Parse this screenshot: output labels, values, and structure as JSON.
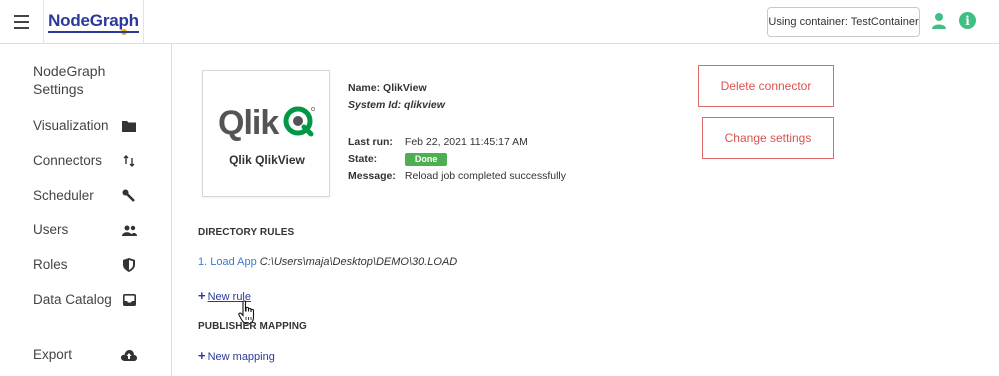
{
  "header": {
    "brand": "NodeGraph",
    "container_label": "Using container: TestContainer",
    "info_glyph": "i",
    "accent_color": "#3fbf83",
    "brand_color": "#2b3a9a"
  },
  "sidebar": {
    "title": "NodeGraph Settings",
    "items": [
      {
        "label": "Visualization",
        "icon": "folder-icon"
      },
      {
        "label": "Connectors",
        "icon": "arrows-updown-icon"
      },
      {
        "label": "Scheduler",
        "icon": "wrench-icon"
      },
      {
        "label": "Users",
        "icon": "users-icon"
      },
      {
        "label": "Roles",
        "icon": "shield-icon"
      },
      {
        "label": "Data Catalog",
        "icon": "inbox-icon"
      },
      {
        "label": "Export",
        "icon": "cloud-upload-icon"
      }
    ]
  },
  "connector": {
    "logo_text": "Qlik",
    "card_name": "Qlik QlikView",
    "name_label": "Name:",
    "name_value": "QlikView",
    "system_id_label": "System Id:",
    "system_id_value": "qlikview",
    "last_run_label": "Last run:",
    "last_run_value": "Feb 22, 2021 11:45:17 AM",
    "state_label": "State:",
    "state_value": "Done",
    "message_label": "Message:",
    "message_value": "Reload job completed successfully",
    "state_color": "#4caf50"
  },
  "actions": {
    "delete_label": "Delete connector",
    "change_label": "Change settings",
    "danger_color": "#d9534f"
  },
  "directory_rules": {
    "title": "DIRECTORY RULES",
    "rules": [
      {
        "link": "1. Load App",
        "path": "C:\\Users\\maja\\Desktop\\DEMO\\30.LOAD"
      }
    ],
    "new_rule_label": "New rule"
  },
  "publisher_mapping": {
    "title": "PUBLISHER MAPPING",
    "new_mapping_label": "New mapping"
  }
}
